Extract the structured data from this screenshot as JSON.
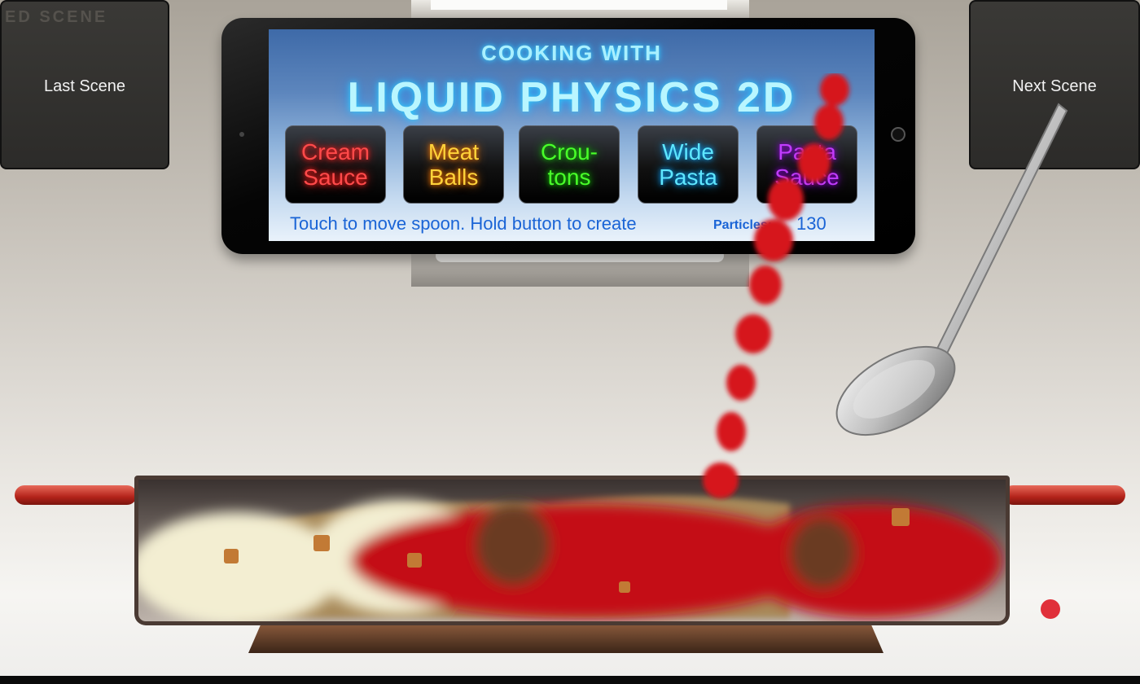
{
  "scene_nav": {
    "last_label": "Last Scene",
    "next_label": "Next Scene",
    "ghost_text": "ED SCENE"
  },
  "tablet": {
    "title_small": "COOKING WITH",
    "title_big": "LIQUID PHYSICS 2D",
    "buttons": [
      {
        "line1": "Cream",
        "line2": "Sauce",
        "color": "#ff4a4a",
        "glow": "#ff1a1a"
      },
      {
        "line1": "Meat",
        "line2": "Balls",
        "color": "#ffd23a",
        "glow": "#ff7a00"
      },
      {
        "line1": "Crou-",
        "line2": "tons",
        "color": "#49ff2a",
        "glow": "#12c000"
      },
      {
        "line1": "Wide",
        "line2": "Pasta",
        "color": "#5ee6ff",
        "glow": "#0aa4ff"
      },
      {
        "line1": "Pasta",
        "line2": "Sauce",
        "color": "#c13cff",
        "glow": "#8a00d6"
      }
    ],
    "status_text": "Touch to move spoon. Hold button to create",
    "particles_label": "Particles:",
    "particles_value": "130"
  },
  "colors": {
    "sauce_red": "#c40e12",
    "cream": "#f3eed2",
    "meatball_brown": "#6a3b22",
    "crouton": "#c27a35",
    "pasta": "#c9a766"
  }
}
